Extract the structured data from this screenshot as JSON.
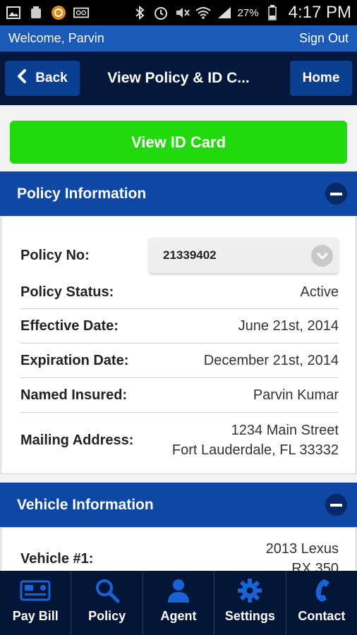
{
  "status_bar": {
    "battery": "27%",
    "time": "4:17 PM"
  },
  "welcome_bar": {
    "greeting": "Welcome, Parvin",
    "sign_out": "Sign Out"
  },
  "nav": {
    "back": "Back",
    "title": "View Policy & ID C...",
    "home": "Home"
  },
  "id_card_button": "View ID Card",
  "policy_section": {
    "title": "Policy Information",
    "policy_no_label": "Policy No:",
    "policy_no_value": "21339402",
    "rows": [
      {
        "label": "Policy Status:",
        "value": "Active"
      },
      {
        "label": "Effective Date:",
        "value": "June 21st, 2014"
      },
      {
        "label": "Expiration Date:",
        "value": "December 21st, 2014"
      },
      {
        "label": "Named Insured:",
        "value": "Parvin Kumar"
      }
    ],
    "address_label": "Mailing Address:",
    "address_line1": "1234 Main Street",
    "address_line2": "Fort Lauderdale, FL 33332"
  },
  "vehicle_section": {
    "title": "Vehicle Information",
    "vehicle_label": "Vehicle #1:",
    "vehicle_line1": "2013 Lexus",
    "vehicle_line2": "RX 350"
  },
  "tab_bar": [
    {
      "label": "Pay Bill",
      "icon": "credit-card-icon"
    },
    {
      "label": "Policy",
      "icon": "search-icon"
    },
    {
      "label": "Agent",
      "icon": "person-icon"
    },
    {
      "label": "Settings",
      "icon": "gear-icon"
    },
    {
      "label": "Contact",
      "icon": "phone-icon"
    }
  ],
  "colors": {
    "primary_blue": "#0e47a4",
    "navy": "#05173a",
    "green": "#22d90d",
    "welcome_blue": "#1b5ab7"
  }
}
